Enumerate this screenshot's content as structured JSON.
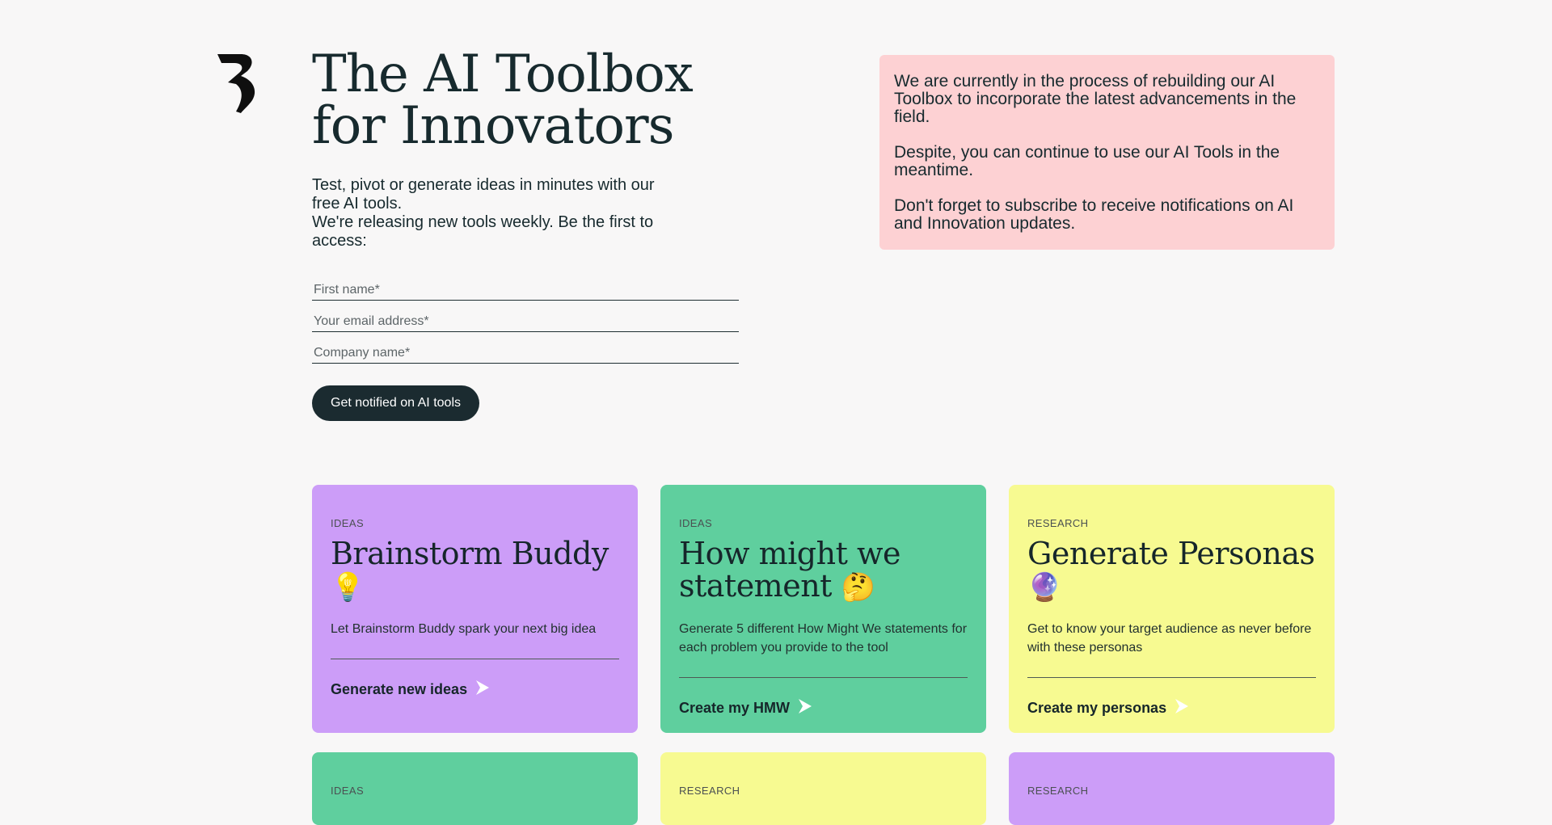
{
  "hero": {
    "title_line1": "The AI Toolbox",
    "title_line2": "for Innovators",
    "lead_line1": "Test, pivot or generate ideas in minutes with our free AI tools.",
    "lead_line2": "We're releasing new tools weekly. Be the first to access:"
  },
  "form": {
    "first_name_placeholder": "First name*",
    "email_placeholder": "Your email address*",
    "company_placeholder": "Company name*",
    "submit_label": "Get notified on AI tools"
  },
  "notice": {
    "p1": "We are currently in the process of rebuilding our AI Toolbox to incorporate the latest advancements in the field.",
    "p2": "Despite, you can continue to use our AI Tools in the meantime.",
    "p3": "Don't forget to subscribe to receive notifications on AI and Innovation updates.",
    "color": "#fdd1d3"
  },
  "cards": [
    {
      "category": "IDEAS",
      "title": "Brainstorm Buddy",
      "emoji": "💡",
      "description": "Let Brainstorm Buddy spark your next big idea",
      "link": "Generate new ideas",
      "color": "#cc9df8"
    },
    {
      "category": "IDEAS",
      "title": "How might we statement",
      "emoji": "🤔",
      "description": "Generate 5 different How Might We statements for each problem you provide to the tool",
      "link": "Create my HMW",
      "color": "#5fcf9e"
    },
    {
      "category": "RESEARCH",
      "title": "Generate Personas",
      "emoji": "🔮",
      "description": "Get to know your target audience as never before with these personas",
      "link": "Create my personas",
      "color": "#f7fa91"
    },
    {
      "category": "IDEAS",
      "title": "",
      "emoji": "",
      "description": "",
      "link": "",
      "color": "#5fcf9e"
    },
    {
      "category": "RESEARCH",
      "title": "",
      "emoji": "",
      "description": "",
      "link": "",
      "color": "#f7fa91"
    },
    {
      "category": "RESEARCH",
      "title": "",
      "emoji": "",
      "description": "",
      "link": "",
      "color": "#cc9df8"
    }
  ],
  "icons": {
    "logo": "brand-logo",
    "arrow": "arrow-right-icon"
  }
}
